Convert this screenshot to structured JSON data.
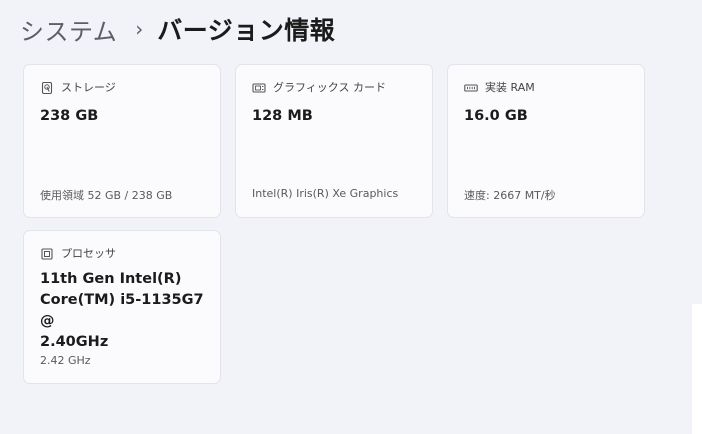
{
  "breadcrumb": {
    "parent": "システム",
    "separator": "›",
    "current": "バージョン情報"
  },
  "cards": {
    "storage": {
      "icon": "storage-drive-icon",
      "title": "ストレージ",
      "value": "238 GB",
      "sub": "使用領域 52 GB / 238 GB"
    },
    "graphics": {
      "icon": "graphics-card-icon",
      "title": "グラフィックス カード",
      "value": "128 MB",
      "sub": "Intel(R) Iris(R) Xe Graphics"
    },
    "ram": {
      "icon": "memory-icon",
      "title": "実装 RAM",
      "value": "16.0 GB",
      "sub": "速度: 2667 MT/秒"
    },
    "processor": {
      "icon": "processor-icon",
      "title": "プロセッサ",
      "value_lines": [
        "11th Gen Intel(R)",
        "Core(TM) i5-1135G7 @",
        "2.40GHz"
      ],
      "sub": "2.42 GHz"
    }
  }
}
